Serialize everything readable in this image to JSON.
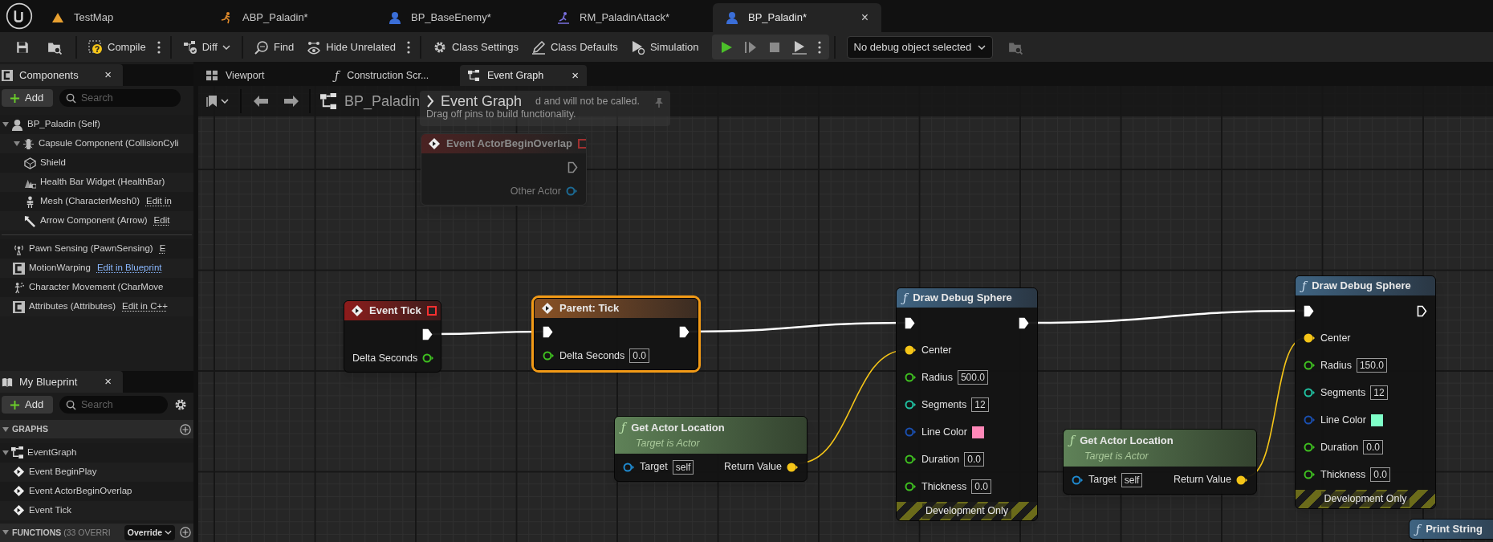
{
  "app_tabs": [
    {
      "label": "TestMap",
      "selected": false
    },
    {
      "label": "ABP_Paladin*",
      "selected": false
    },
    {
      "label": "BP_BaseEnemy*",
      "selected": false
    },
    {
      "label": "RM_PaladinAttack*",
      "selected": false
    },
    {
      "label": "BP_Paladin*",
      "selected": true,
      "close": "×"
    }
  ],
  "toolbar": [
    {
      "kind": "icon"
    },
    {
      "kind": "icon"
    },
    {
      "kind": "separator"
    },
    {
      "kind": "button",
      "label": "Compile"
    },
    {
      "kind": "menu"
    },
    {
      "kind": "separator"
    },
    {
      "kind": "dropdown",
      "label": "Diff"
    },
    {
      "kind": "separator"
    },
    {
      "kind": "button",
      "label": "Find"
    },
    {
      "kind": "button",
      "label": "Hide Unrelated"
    },
    {
      "kind": "menu"
    },
    {
      "kind": "separator"
    },
    {
      "kind": "button",
      "label": "Class Settings"
    },
    {
      "kind": "button",
      "label": "Class Defaults"
    },
    {
      "kind": "button",
      "label": "Simulation"
    },
    {
      "kind": "play_group"
    },
    {
      "kind": "separator"
    },
    {
      "kind": "select",
      "label": "No debug object selected"
    },
    {
      "kind": "icon"
    }
  ],
  "components": {
    "tab": {
      "label": "Components",
      "close": "×"
    },
    "add": "Add",
    "search": {
      "placeholder": "Search"
    },
    "tree": [
      {
        "label": "BP_Paladin (Self)",
        "selected": false,
        "expanded": true,
        "children": [
          {
            "label": "Capsule Component (CollisionCyli",
            "selected": false,
            "expanded": true,
            "children": [
              {
                "label": "Shield",
                "selected": false
              },
              {
                "label": "Health Bar Widget (HealthBar)",
                "selected": false
              },
              {
                "label": "Mesh (CharacterMesh0)",
                "selected": false,
                "link": "Edit in",
                "hovered": false
              },
              {
                "label": "Arrow Component (Arrow)",
                "selected": false,
                "link": "Edit",
                "hovered": false
              }
            ]
          }
        ]
      }
    ],
    "other": [
      {
        "label": "Pawn Sensing (PawnSensing)",
        "selected": false,
        "link": "E",
        "hovered": false
      },
      {
        "label": "MotionWarping",
        "selected": false,
        "link": "Edit in Blueprint",
        "hovered": true
      },
      {
        "label": "Character Movement (CharMove",
        "selected": false
      },
      {
        "label": "Attributes (Attributes)",
        "selected": false,
        "link": "Edit in C++",
        "hovered": false
      }
    ]
  },
  "my_blueprint": {
    "tab": {
      "label": "My Blueprint",
      "close": "×"
    },
    "add": "Add",
    "search": {
      "placeholder": "Search"
    },
    "sections": [
      {
        "title": "GRAPHS",
        "expanded": true,
        "items": [
          {
            "label": "EventGraph",
            "selected": false,
            "expanded": true,
            "children": [
              {
                "label": "Event BeginPlay",
                "selected": false
              },
              {
                "label": "Event ActorBeginOverlap",
                "selected": false
              },
              {
                "label": "Event Tick",
                "selected": false
              }
            ]
          }
        ]
      },
      {
        "title": "FUNCTIONS",
        "note": "(33 OVERRI",
        "action": "Override",
        "expanded": true
      }
    ]
  },
  "editor_tabs": [
    {
      "label": "Viewport",
      "selected": false
    },
    {
      "label": "Construction Scr...",
      "glyph": "ƒ",
      "selected": false
    },
    {
      "label": "Event Graph",
      "selected": true,
      "close": "×"
    }
  ],
  "breadcrumb": {
    "blueprint": "BP_Paladin",
    "graph": "Event Graph"
  },
  "tooltip": {
    "lines": [
      "d and will not be called.",
      "Drag off pins to build functionality."
    ]
  },
  "nodes": [
    {
      "kind": "event",
      "title": "Event ActorBeginOverlap",
      "disabled": true,
      "selected": false,
      "rows": [
        {
          "right": {
            "kind": "exec",
            "linked": false
          }
        },
        {
          "right": {
            "kind": "data",
            "label": "Other Actor",
            "color": "#1c6a94",
            "linked": false
          }
        }
      ]
    },
    {
      "kind": "event",
      "title": "Event Tick",
      "disabled": false,
      "selected": false,
      "rows": [
        {
          "right": {
            "kind": "exec",
            "linked": true
          }
        },
        {
          "right": {
            "kind": "data",
            "label": "Delta Seconds",
            "color": "#3fc020",
            "linked": false
          }
        }
      ]
    },
    {
      "kind": "parent_call",
      "title": "Parent: Tick",
      "disabled": false,
      "selected": true,
      "rows": [
        {
          "left": {
            "kind": "exec",
            "linked": true
          },
          "right": {
            "kind": "exec",
            "linked": true
          }
        },
        {
          "left": {
            "kind": "data",
            "label": "Delta Seconds",
            "color": "#3fc020",
            "linked": false,
            "value": "0.0"
          }
        }
      ]
    },
    {
      "kind": "pure_function",
      "glyph": "ƒ",
      "title": "Get Actor Location",
      "subtitle": "Target is Actor",
      "disabled": false,
      "selected": false,
      "rows": [
        {
          "left": {
            "kind": "data",
            "label": "Target",
            "color": "#1f8ad0",
            "linked": false,
            "value": "self"
          },
          "right": {
            "kind": "data",
            "label": "Return Value",
            "color": "#f5c518",
            "linked": true
          }
        }
      ]
    },
    {
      "kind": "function",
      "glyph": "ƒ",
      "title": "Draw Debug Sphere",
      "footer": "Development Only",
      "disabled": false,
      "selected": false,
      "rows": [
        {
          "left": {
            "kind": "exec",
            "linked": true
          },
          "right": {
            "kind": "exec",
            "linked": true
          }
        },
        {
          "left": {
            "kind": "data",
            "label": "Center",
            "color": "#f5c518",
            "linked": true
          }
        },
        {
          "left": {
            "kind": "data",
            "label": "Radius",
            "color": "#3fc020",
            "linked": false,
            "value": "500.0"
          }
        },
        {
          "left": {
            "kind": "data",
            "label": "Segments",
            "color": "#20c0a0",
            "linked": false,
            "value": "12"
          }
        },
        {
          "left": {
            "kind": "data",
            "label": "Line Color",
            "color": "#1a4fb0",
            "linked": false,
            "swatch": {
              "color": "#ff88b8"
            }
          }
        },
        {
          "left": {
            "kind": "data",
            "label": "Duration",
            "color": "#3fc020",
            "linked": false,
            "value": "0.0"
          }
        },
        {
          "left": {
            "kind": "data",
            "label": "Thickness",
            "color": "#3fc020",
            "linked": false,
            "value": "0.0"
          }
        }
      ]
    },
    {
      "kind": "pure_function",
      "glyph": "ƒ",
      "title": "Get Actor Location",
      "subtitle": "Target is Actor",
      "disabled": false,
      "selected": false,
      "rows": [
        {
          "left": {
            "kind": "data",
            "label": "Target",
            "color": "#1f8ad0",
            "linked": false,
            "value": "self"
          },
          "right": {
            "kind": "data",
            "label": "Return Value",
            "color": "#f5c518",
            "linked": true
          }
        }
      ]
    },
    {
      "kind": "function",
      "glyph": "ƒ",
      "title": "Draw Debug Sphere",
      "footer": "Development Only",
      "disabled": false,
      "selected": false,
      "rows": [
        {
          "left": {
            "kind": "exec",
            "linked": true
          },
          "right": {
            "kind": "exec",
            "linked": false
          }
        },
        {
          "left": {
            "kind": "data",
            "label": "Center",
            "color": "#f5c518",
            "linked": true
          }
        },
        {
          "left": {
            "kind": "data",
            "label": "Radius",
            "color": "#3fc020",
            "linked": false,
            "value": "150.0"
          }
        },
        {
          "left": {
            "kind": "data",
            "label": "Segments",
            "color": "#20c0a0",
            "linked": false,
            "value": "12"
          }
        },
        {
          "left": {
            "kind": "data",
            "label": "Line Color",
            "color": "#1a4fb0",
            "linked": false,
            "swatch": {
              "color": "#7fffc8"
            }
          }
        },
        {
          "left": {
            "kind": "data",
            "label": "Duration",
            "color": "#3fc020",
            "linked": false,
            "value": "0.0"
          }
        },
        {
          "left": {
            "kind": "data",
            "label": "Thickness",
            "color": "#3fc020",
            "linked": false,
            "value": "0.0"
          }
        }
      ]
    },
    {
      "kind": "function",
      "glyph": "ƒ",
      "title": "Print String",
      "disabled": false,
      "selected": false
    }
  ]
}
